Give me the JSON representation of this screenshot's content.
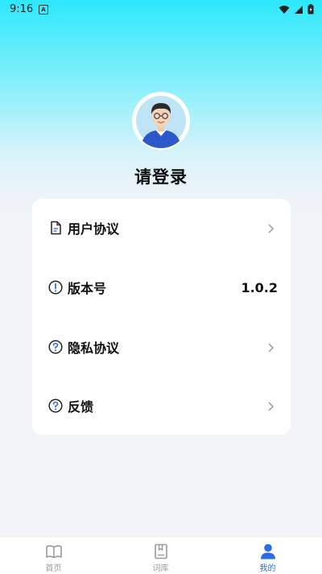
{
  "status_bar": {
    "time": "9:16",
    "notification": "A"
  },
  "profile": {
    "login_prompt": "请登录"
  },
  "menu": {
    "items": [
      {
        "label": "用户协议",
        "icon": "document-icon",
        "chevron": true
      },
      {
        "label": "版本号",
        "icon": "info-icon",
        "value": "1.0.2"
      },
      {
        "label": "隐私协议",
        "icon": "question-icon",
        "chevron": true
      },
      {
        "label": "反馈",
        "icon": "question-icon",
        "chevron": true
      }
    ]
  },
  "tab_bar": {
    "tabs": [
      {
        "label": "首页",
        "icon": "book-icon",
        "active": false
      },
      {
        "label": "词库",
        "icon": "wordbook-icon",
        "active": false
      },
      {
        "label": "我的",
        "icon": "person-icon",
        "active": true
      }
    ]
  },
  "colors": {
    "accent": "#2a6be8",
    "inactive": "#9a9a9a",
    "gradient_top": "#2de8fc"
  }
}
